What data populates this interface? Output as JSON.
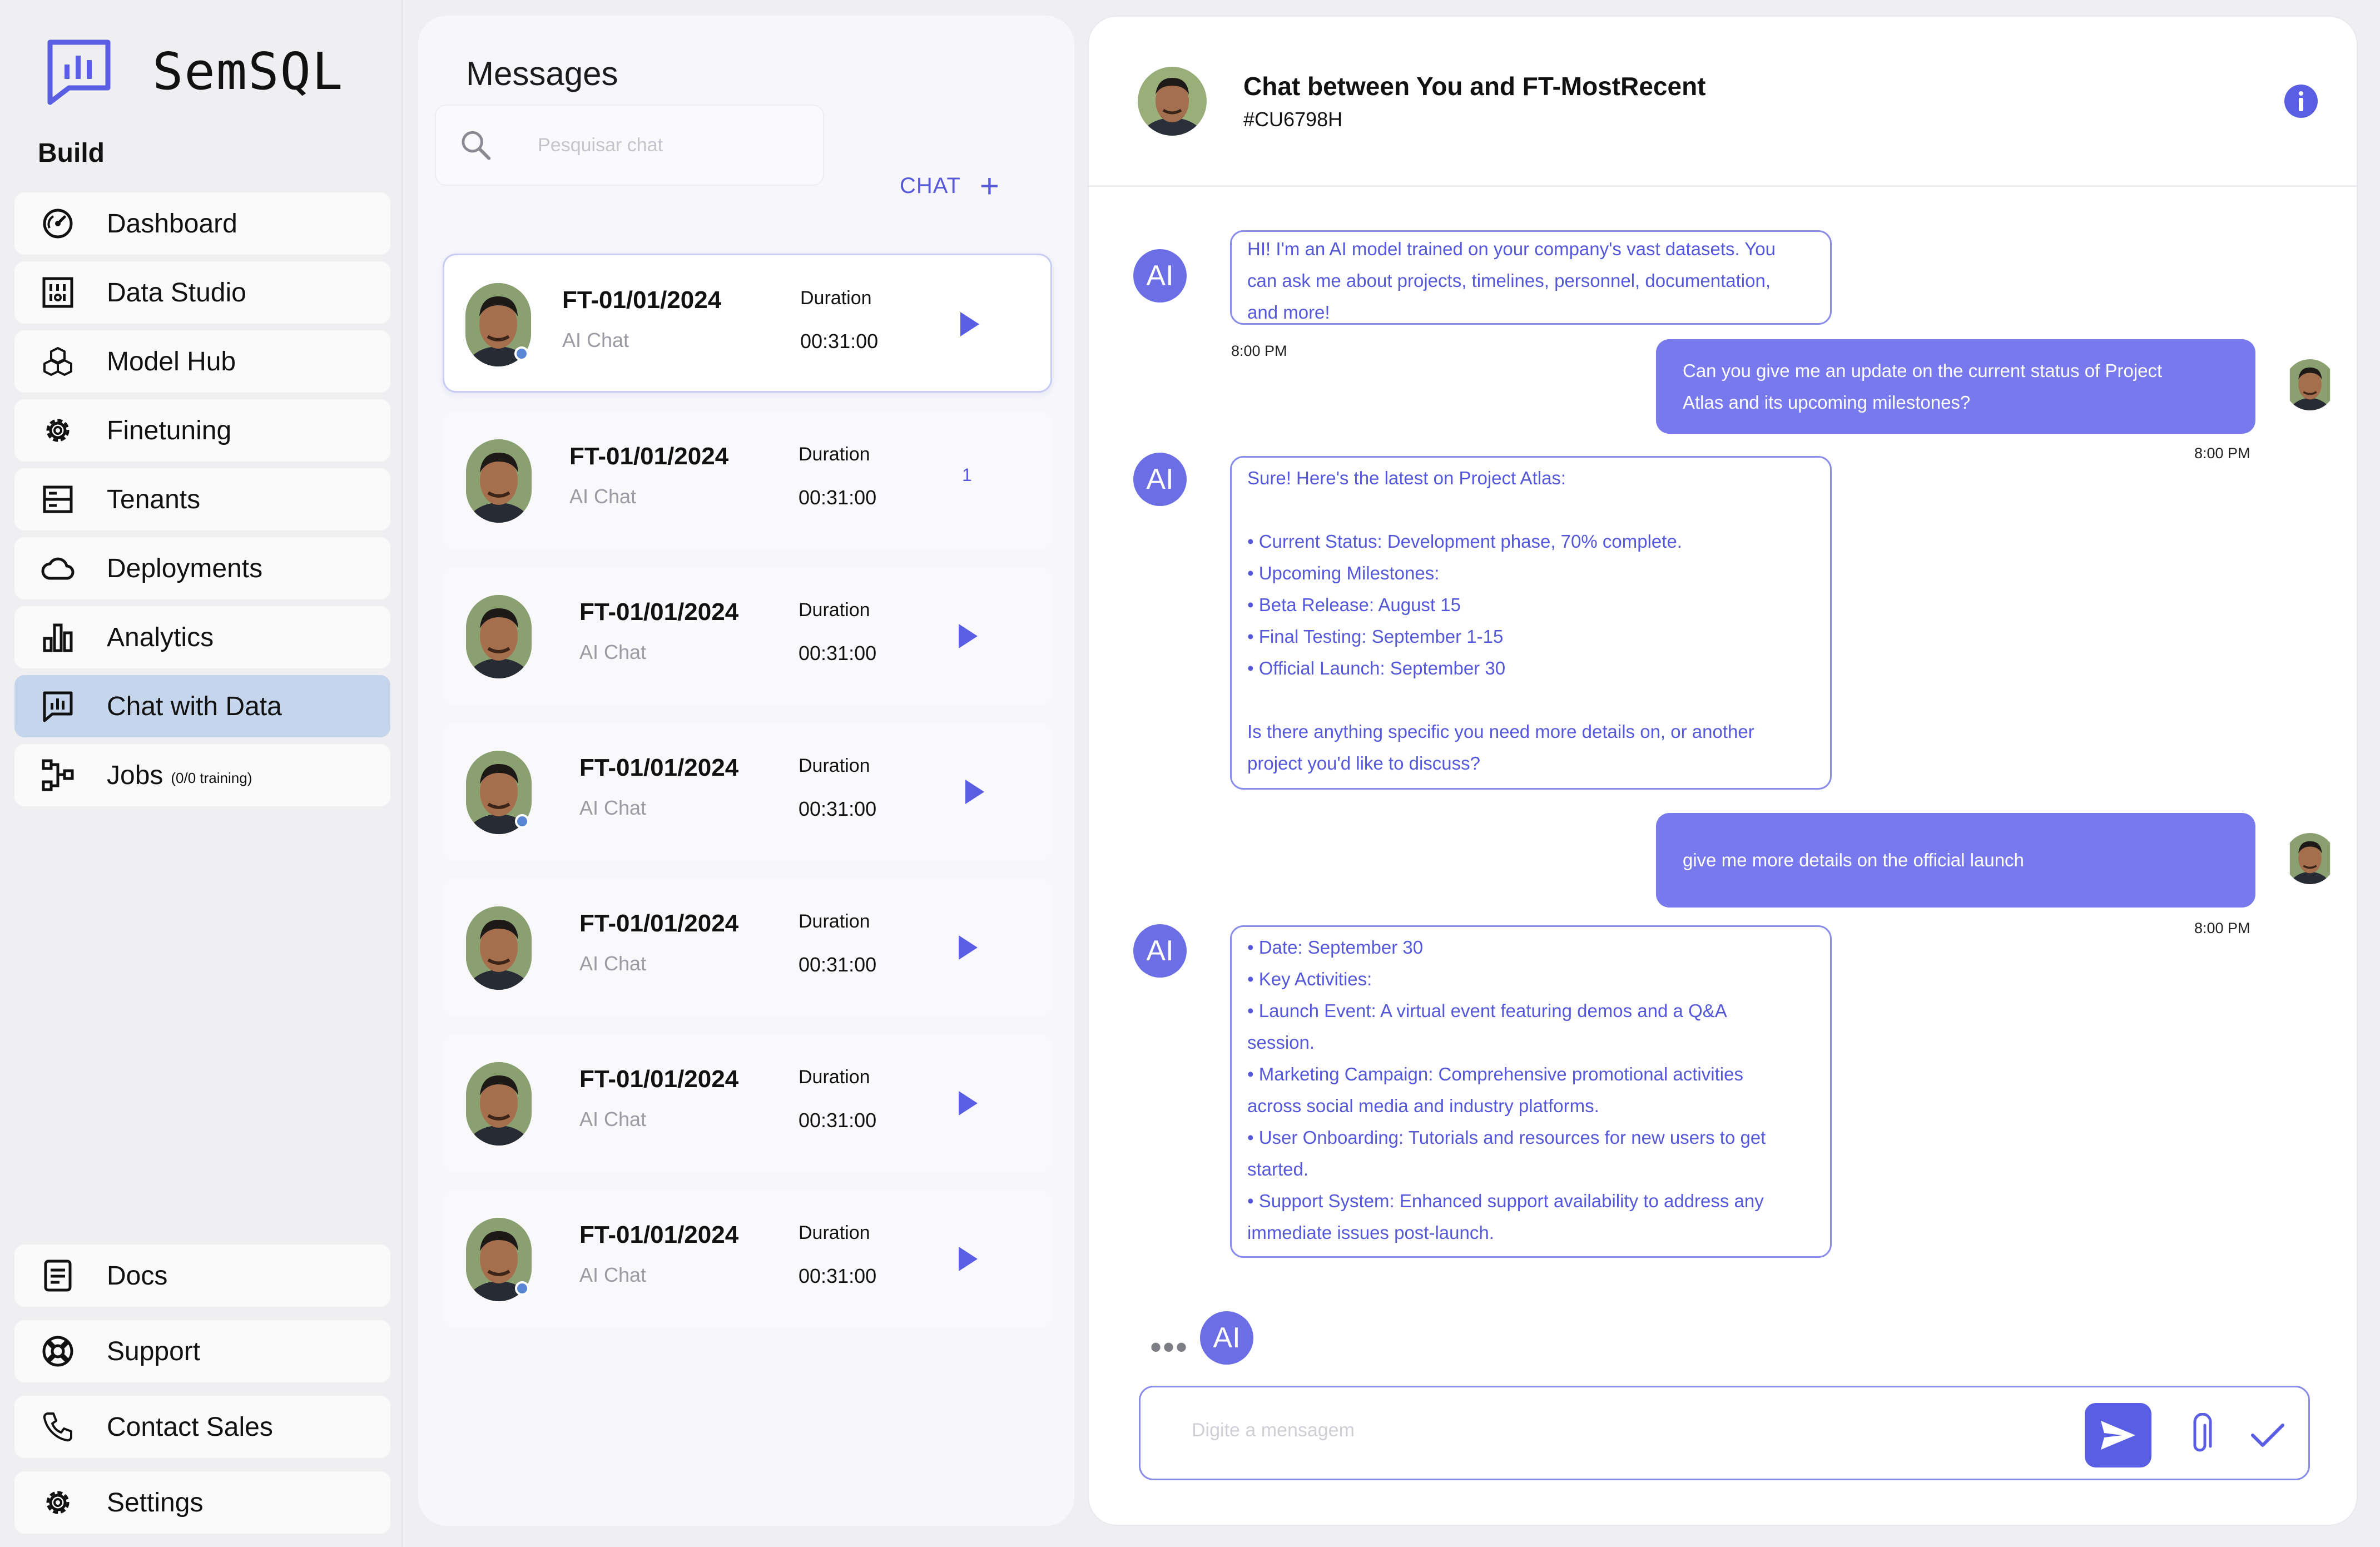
{
  "brand": {
    "name": "SemSQL",
    "accent": "#5558d9"
  },
  "sidebar": {
    "section_label": "Build",
    "items": [
      {
        "label": "Dashboard",
        "icon": "dashboard-gauge-icon"
      },
      {
        "label": "Data Studio",
        "icon": "data-studio-icon"
      },
      {
        "label": "Model Hub",
        "icon": "cubes-icon"
      },
      {
        "label": "Finetuning",
        "icon": "gear-icon"
      },
      {
        "label": "Tenants",
        "icon": "server-icon"
      },
      {
        "label": "Deployments",
        "icon": "cloud-icon"
      },
      {
        "label": "Analytics",
        "icon": "bar-chart-icon"
      },
      {
        "label": "Chat with Data",
        "icon": "chat-chart-icon",
        "active": true
      },
      {
        "label": "Jobs",
        "sub": "(0/0 training)",
        "icon": "workflow-icon"
      }
    ],
    "bottom_items": [
      {
        "label": "Docs",
        "icon": "document-icon"
      },
      {
        "label": "Support",
        "icon": "lifebuoy-icon"
      },
      {
        "label": "Contact Sales",
        "icon": "phone-icon"
      },
      {
        "label": "Settings",
        "icon": "gear-icon"
      }
    ]
  },
  "messages": {
    "title": "Messages",
    "search_placeholder": "Pesquisar chat",
    "new_chat_label": "CHAT",
    "conversations": [
      {
        "name": "FT-01/01/2024",
        "subtitle": "AI Chat",
        "duration_label": "Duration",
        "duration": "00:31:00",
        "action": "play",
        "online": true,
        "selected": true
      },
      {
        "name": "FT-01/01/2024",
        "subtitle": "AI Chat",
        "duration_label": "Duration",
        "duration": "00:31:00",
        "action": "badge",
        "badge": "1",
        "online": false
      },
      {
        "name": "FT-01/01/2024",
        "subtitle": "AI Chat",
        "duration_label": "Duration",
        "duration": "00:31:00",
        "action": "play",
        "online": false
      },
      {
        "name": "FT-01/01/2024",
        "subtitle": "AI Chat",
        "duration_label": "Duration",
        "duration": "00:31:00",
        "action": "play",
        "online": true
      },
      {
        "name": "FT-01/01/2024",
        "subtitle": "AI Chat",
        "duration_label": "Duration",
        "duration": "00:31:00",
        "action": "play",
        "online": false
      },
      {
        "name": "FT-01/01/2024",
        "subtitle": "AI Chat",
        "duration_label": "Duration",
        "duration": "00:31:00",
        "action": "play",
        "online": false
      },
      {
        "name": "FT-01/01/2024",
        "subtitle": "AI Chat",
        "duration_label": "Duration",
        "duration": "00:31:00",
        "action": "play",
        "online": true
      }
    ]
  },
  "chat": {
    "title": "Chat between You and FT-MostRecent",
    "id": "#CU6798H",
    "ai_label": "AI",
    "typing": "•••",
    "composer_placeholder": "Digite a mensagem",
    "messages": [
      {
        "role": "ai",
        "lines": [
          "HI! I'm an AI model trained on your company's vast datasets. You",
          "can ask me about projects, timelines, personnel, documentation,",
          "and more!"
        ],
        "time": "8:00 PM"
      },
      {
        "role": "user",
        "lines": [
          "Can you give me an update on the current status of Project",
          "Atlas and its upcoming milestones?"
        ],
        "time": "8:00 PM"
      },
      {
        "role": "ai",
        "lines": [
          "Sure! Here's the latest on Project Atlas:",
          "",
          "• Current Status: Development phase, 70% complete.",
          "• Upcoming Milestones:",
          "• Beta Release: August 15",
          "• Final Testing: September 1-15",
          "• Official Launch: September 30",
          "",
          "Is there anything specific you need more details on, or another",
          "project you'd like to discuss?"
        ]
      },
      {
        "role": "user",
        "lines": [
          "give me more details on the official launch"
        ],
        "time": "8:00 PM"
      },
      {
        "role": "ai",
        "lines": [
          "• Date: September 30",
          "• Key Activities:",
          "• Launch Event: A virtual event featuring demos and a Q&A",
          "session.",
          "• Marketing Campaign: Comprehensive promotional activities",
          "across social media and industry platforms.",
          "• User Onboarding: Tutorials and resources for new users to get",
          "started.",
          "• Support System: Enhanced support availability to address any",
          "immediate issues post-launch."
        ]
      }
    ]
  }
}
